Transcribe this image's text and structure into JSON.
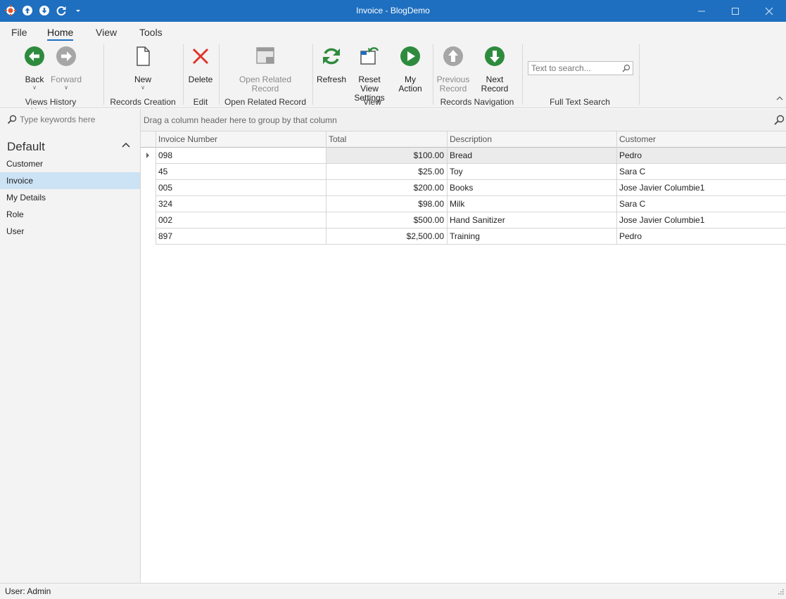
{
  "window": {
    "title": "Invoice - BlogDemo",
    "quick_access": [
      "app-icon",
      "arrow-up-circle-icon",
      "arrow-down-circle-icon",
      "refresh-icon",
      "dropdown-icon"
    ],
    "controls": [
      "minimize-icon",
      "maximize-icon",
      "close-icon"
    ]
  },
  "ribbon": {
    "tabs": [
      {
        "label": "File",
        "active": false
      },
      {
        "label": "Home",
        "active": true
      },
      {
        "label": "View",
        "active": false
      },
      {
        "label": "Tools",
        "active": false
      }
    ],
    "buttons": {
      "back": {
        "label": "Back",
        "icon": "back-arrow-icon",
        "enabled": true
      },
      "forward": {
        "label": "Forward",
        "icon": "forward-arrow-icon",
        "enabled": false
      },
      "new": {
        "label": "New",
        "icon": "new-document-icon",
        "enabled": true
      },
      "delete": {
        "label": "Delete",
        "icon": "delete-x-icon",
        "enabled": true
      },
      "open_related_line1": "Open Related",
      "open_related_line2": "Record",
      "refresh": {
        "label": "Refresh",
        "icon": "refresh-icon",
        "enabled": true
      },
      "reset_view_line1": "Reset View",
      "reset_view_line2": "Settings",
      "my_action": {
        "label": "My Action",
        "icon": "play-icon",
        "enabled": true
      },
      "previous_line1": "Previous",
      "previous_line2": "Record",
      "next_record": {
        "label": "Next Record",
        "icon": "arrow-down-circle-icon",
        "enabled": true
      }
    },
    "groups": {
      "views_history": "Views History Navigation",
      "records_creation": "Records Creation",
      "edit": "Edit",
      "open_related": "Open Related Record",
      "view": "View",
      "records_navigation": "Records Navigation",
      "full_text_search": "Full Text Search"
    },
    "search": {
      "placeholder": "Text to search..."
    }
  },
  "navigation": {
    "search_placeholder": "Type keywords here",
    "group_title": "Default",
    "items": [
      {
        "label": "Customer",
        "selected": false
      },
      {
        "label": "Invoice",
        "selected": true
      },
      {
        "label": "My Details",
        "selected": false
      },
      {
        "label": "Role",
        "selected": false
      },
      {
        "label": "User",
        "selected": false
      }
    ]
  },
  "grid": {
    "group_panel_hint": "Drag a column header here to group by that column",
    "columns": [
      "Invoice Number",
      "Total",
      "Description",
      "Customer"
    ],
    "rows": [
      {
        "number": "098",
        "total": "$100.00",
        "description": "Bread",
        "customer": "Pedro",
        "focused": true
      },
      {
        "number": "45",
        "total": "$25.00",
        "description": "Toy",
        "customer": "Sara C",
        "focused": false
      },
      {
        "number": "005",
        "total": "$200.00",
        "description": "Books",
        "customer": "Jose Javier Columbie1",
        "focused": false
      },
      {
        "number": "324",
        "total": "$98.00",
        "description": "Milk",
        "customer": "Sara C",
        "focused": false
      },
      {
        "number": "002",
        "total": "$500.00",
        "description": "Hand Sanitizer",
        "customer": "Jose Javier Columbie1",
        "focused": false
      },
      {
        "number": "897",
        "total": "$2,500.00",
        "description": "Training",
        "customer": "Pedro",
        "focused": false
      }
    ]
  },
  "status_bar": {
    "user": "User: Admin"
  },
  "colors": {
    "accent": "#1e6fbf",
    "green": "#2e8b3e",
    "disabled": "#a0a0a0",
    "delete": "#e0352b",
    "selection": "#cce3f5"
  }
}
